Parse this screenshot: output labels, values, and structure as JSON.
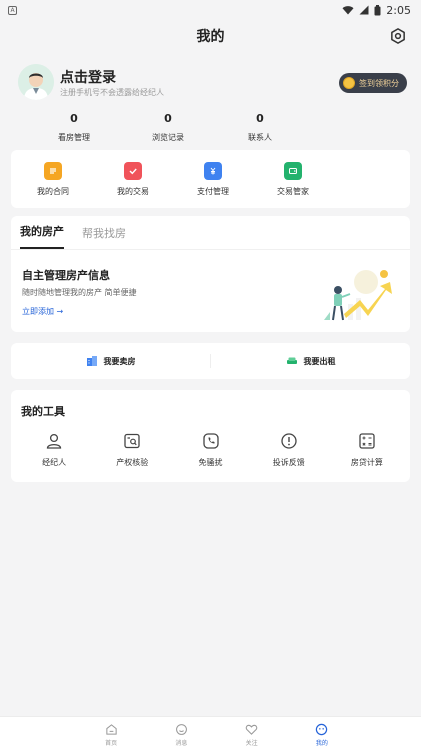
{
  "status": {
    "time": "2:05",
    "notif_glyph": "A"
  },
  "header": {
    "title": "我的"
  },
  "profile": {
    "login_title": "点击登录",
    "login_sub": "注册手机号不会透露给经纪人",
    "signin_label": "签到领积分"
  },
  "stats": [
    {
      "num": "0",
      "label": "看房管理"
    },
    {
      "num": "0",
      "label": "浏览记录"
    },
    {
      "num": "0",
      "label": "联系人"
    }
  ],
  "quick": [
    {
      "label": "我的合同",
      "icon": "contract-icon",
      "color": "#f5a623"
    },
    {
      "label": "我的交易",
      "icon": "trade-icon",
      "color": "#f0535a"
    },
    {
      "label": "支付管理",
      "icon": "payment-icon",
      "color": "#3f82f0"
    },
    {
      "label": "交易管家",
      "icon": "wallet-icon",
      "color": "#23b26d"
    }
  ],
  "property": {
    "tabs": [
      "我的房产",
      "帮我找房"
    ],
    "title": "自主管理房产信息",
    "sub": "随时随地管理我的房产 简单便捷",
    "add_link": "立即添加 →"
  },
  "sellrent": {
    "sell": "我要卖房",
    "rent": "我要出租"
  },
  "tools": {
    "title": "我的工具",
    "items": [
      "经纪人",
      "产权核验",
      "免骚扰",
      "投诉反馈",
      "房贷计算"
    ]
  },
  "tabbar": [
    "首页",
    "消息",
    "关注",
    "我的"
  ]
}
